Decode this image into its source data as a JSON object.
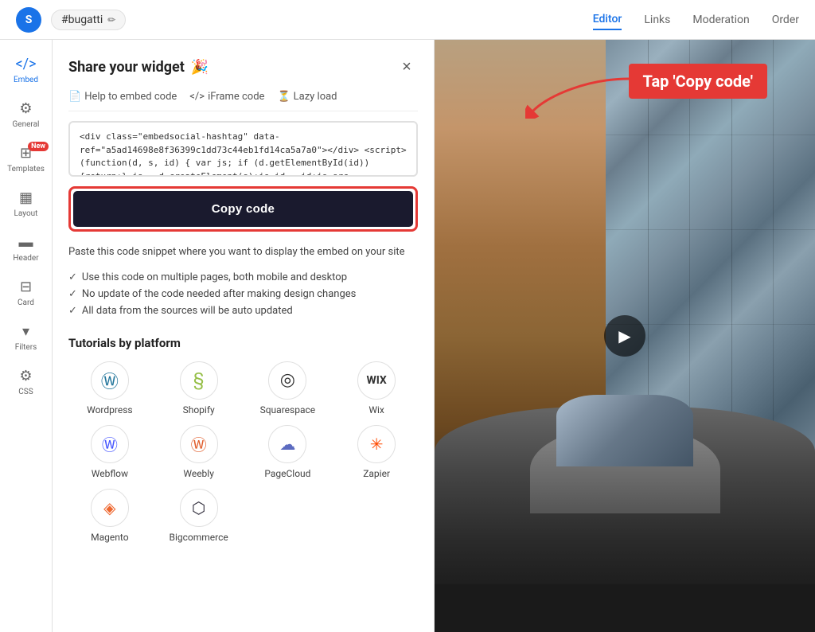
{
  "app": {
    "logo": "S",
    "hashtag": "#bugatti"
  },
  "nav": {
    "tabs": [
      {
        "id": "editor",
        "label": "Editor",
        "active": true
      },
      {
        "id": "links",
        "label": "Links",
        "active": false
      },
      {
        "id": "moderation",
        "label": "Moderation",
        "active": false
      },
      {
        "id": "order",
        "label": "Order",
        "active": false
      }
    ]
  },
  "sidebar": {
    "items": [
      {
        "id": "embed",
        "label": "Embed",
        "icon": "</>",
        "active": true
      },
      {
        "id": "general",
        "label": "General",
        "icon": "⚙",
        "active": false
      },
      {
        "id": "templates",
        "label": "Templates",
        "icon": "⊞",
        "active": false,
        "badge": "New"
      },
      {
        "id": "layout",
        "label": "Layout",
        "icon": "▦",
        "active": false
      },
      {
        "id": "header",
        "label": "Header",
        "icon": "▬",
        "active": false
      },
      {
        "id": "card",
        "label": "Card",
        "icon": "⊟",
        "active": false
      },
      {
        "id": "filters",
        "label": "Filters",
        "icon": "▾",
        "active": false
      },
      {
        "id": "css",
        "label": "CSS",
        "icon": "⚙",
        "active": false
      }
    ]
  },
  "panel": {
    "title": "Share your widget",
    "title_emoji": "🎉",
    "close_label": "×",
    "code_tabs": [
      {
        "id": "help",
        "icon": "📄",
        "label": "Help to embed code"
      },
      {
        "id": "iframe",
        "icon": "</>",
        "label": "iFrame code"
      },
      {
        "id": "lazy",
        "icon": "⏳",
        "label": "Lazy load"
      }
    ],
    "code_snippet": "<div class=\"embedsocial-hashtag\" data-ref=\"a5ad14698e8f36399c1dd73c44eb1fd14ca5a7a0\"></div> <script> (function(d, s, id) { var js; if (d.getElementById(id)) {return;} js = d.createElement(s);js.id = id;js.src = \"https://embedsoci...",
    "copy_button_label": "Copy code",
    "paste_info": "Paste this code snippet where you want to display the embed on your site",
    "features": [
      "Use this code on multiple pages, both mobile and desktop",
      "No update of the code needed after making design changes",
      "All data from the sources will be auto updated"
    ],
    "tutorials_title": "Tutorials by platform",
    "platforms": [
      {
        "id": "wordpress",
        "label": "Wordpress",
        "icon": "Ⓦ"
      },
      {
        "id": "shopify",
        "label": "Shopify",
        "icon": "§"
      },
      {
        "id": "squarespace",
        "label": "Squarespace",
        "icon": "◎"
      },
      {
        "id": "wix",
        "label": "Wix",
        "icon": "Ⓦ"
      },
      {
        "id": "webflow",
        "label": "Webflow",
        "icon": "Ⓦ"
      },
      {
        "id": "weebly",
        "label": "Weebly",
        "icon": "Ⓦ"
      },
      {
        "id": "pagecloud",
        "label": "PageCloud",
        "icon": "☁"
      },
      {
        "id": "zapier",
        "label": "Zapier",
        "icon": "✳"
      },
      {
        "id": "magento",
        "label": "Magento",
        "icon": "◈"
      },
      {
        "id": "bigcommerce",
        "label": "Bigcommerce",
        "icon": "⬡"
      }
    ]
  },
  "annotation": {
    "label": "Tap 'Copy code'"
  }
}
